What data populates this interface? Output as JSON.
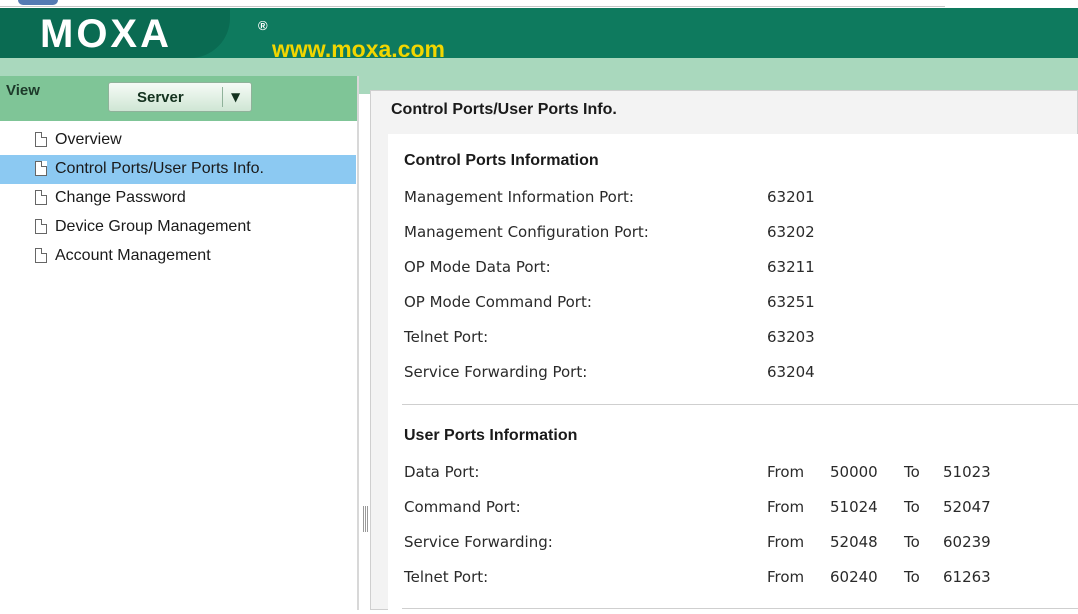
{
  "header": {
    "logo": "MOXA",
    "registered": "®",
    "website": "www.moxa.com"
  },
  "left_panel": {
    "view_label": "View",
    "server_dropdown": {
      "value": "Server",
      "arrow": "▼"
    },
    "tree_items": [
      {
        "label": "Overview",
        "icon": "document-icon",
        "selected": false
      },
      {
        "label": "Control Ports/User Ports Info.",
        "icon": "document-icon",
        "selected": true
      },
      {
        "label": "Change Password",
        "icon": "document-icon",
        "selected": false
      },
      {
        "label": "Device Group Management",
        "icon": "document-icon",
        "selected": false
      },
      {
        "label": "Account Management",
        "icon": "document-icon",
        "selected": false
      }
    ]
  },
  "main": {
    "title": "Control Ports/User Ports Info.",
    "control_ports": {
      "heading": "Control Ports Information",
      "rows": [
        {
          "label": "Management Information Port:",
          "value": "63201"
        },
        {
          "label": "Management Configuration Port:",
          "value": "63202"
        },
        {
          "label": "OP Mode Data Port:",
          "value": "63211"
        },
        {
          "label": "OP Mode Command Port:",
          "value": "63251"
        },
        {
          "label": "Telnet Port:",
          "value": "63203"
        },
        {
          "label": "Service Forwarding Port:",
          "value": "63204"
        }
      ]
    },
    "user_ports": {
      "heading": "User Ports Information",
      "from_label": "From",
      "to_label": "To",
      "rows": [
        {
          "label": "Data Port:",
          "from": "50000",
          "to": "51023"
        },
        {
          "label": "Command Port:",
          "from": "51024",
          "to": "52047"
        },
        {
          "label": "Service Forwarding:",
          "from": "52048",
          "to": "60239"
        },
        {
          "label": "Telnet Port:",
          "from": "60240",
          "to": "61263"
        }
      ]
    }
  },
  "colors": {
    "header_green": "#0e7a5e",
    "light_green": "#a9d8bd",
    "selection_blue": "#8cc9f2",
    "website_yellow": "#f2d600"
  }
}
